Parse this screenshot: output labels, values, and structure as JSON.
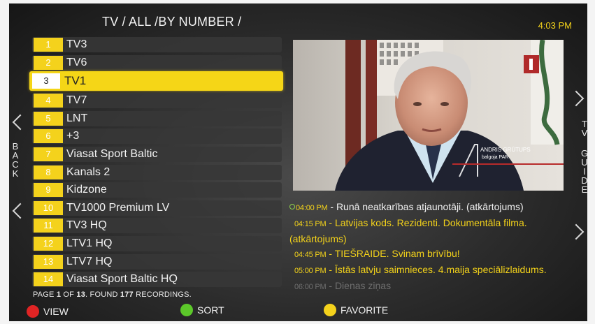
{
  "header": {
    "title": "TV / ALL /BY NUMBER /",
    "clock": "4:03 PM"
  },
  "channels": [
    {
      "num": "1",
      "name": "TV3"
    },
    {
      "num": "2",
      "name": "TV6"
    },
    {
      "num": "3",
      "name": "TV1",
      "selected": true
    },
    {
      "num": "4",
      "name": "TV7"
    },
    {
      "num": "5",
      "name": "LNT"
    },
    {
      "num": "6",
      "name": "+3"
    },
    {
      "num": "7",
      "name": "Viasat Sport Baltic"
    },
    {
      "num": "8",
      "name": "Kanals 2"
    },
    {
      "num": "9",
      "name": "Kidzone"
    },
    {
      "num": "10",
      "name": "TV1000 Premium LV"
    },
    {
      "num": "11",
      "name": "TV3 HQ"
    },
    {
      "num": "12",
      "name": "LTV1 HQ"
    },
    {
      "num": "13",
      "name": "LTV7 HQ"
    },
    {
      "num": "14",
      "name": "Viasat Sport Baltic HQ"
    }
  ],
  "paging": {
    "page_word": "PAGE",
    "page": "1",
    "of_word": "OF",
    "pages": "13",
    "found_word": ". FOUND",
    "count": "177",
    "recordings_word": "RECORDINGS."
  },
  "nav": {
    "back_letters": [
      "B",
      "A",
      "C",
      "K"
    ],
    "guide_letters_1": [
      "T",
      "V"
    ],
    "guide_letters_2": [
      "G",
      "U",
      "I",
      "D",
      "E"
    ]
  },
  "preview": {
    "caption_name": "ANDRIS GRŪTUPS",
    "caption_role": "balgoja PAR",
    "channel_logo": "ltv-logo"
  },
  "epg": [
    {
      "time": "04:00 PM",
      "title": "Runā neatkarības atjaunotāji. (atkārtojums)",
      "current": true
    },
    {
      "time": "04:15 PM",
      "title": "Latvijas kods. Rezidenti. Dokumentāla filma.",
      "title2": "(atkārtojums)"
    },
    {
      "time": "04:45 PM",
      "title": "TIEŠRAIDE. Svinam brīvību!"
    },
    {
      "time": "05:00 PM",
      "title": "Īstās latvju saimnieces. 4.maija speciālizlaidums."
    },
    {
      "time": "06:00 PM",
      "title": "Dienas ziņas"
    }
  ],
  "buttons": {
    "view": {
      "label": "VIEW",
      "color": "#e02424"
    },
    "sort": {
      "label": "SORT",
      "color": "#5cc82a"
    },
    "favorite": {
      "label": "FAVORITE",
      "color": "#f4d21c"
    }
  },
  "colors": {
    "accent": "#f4d21c",
    "time_text": "#f3d21a"
  }
}
